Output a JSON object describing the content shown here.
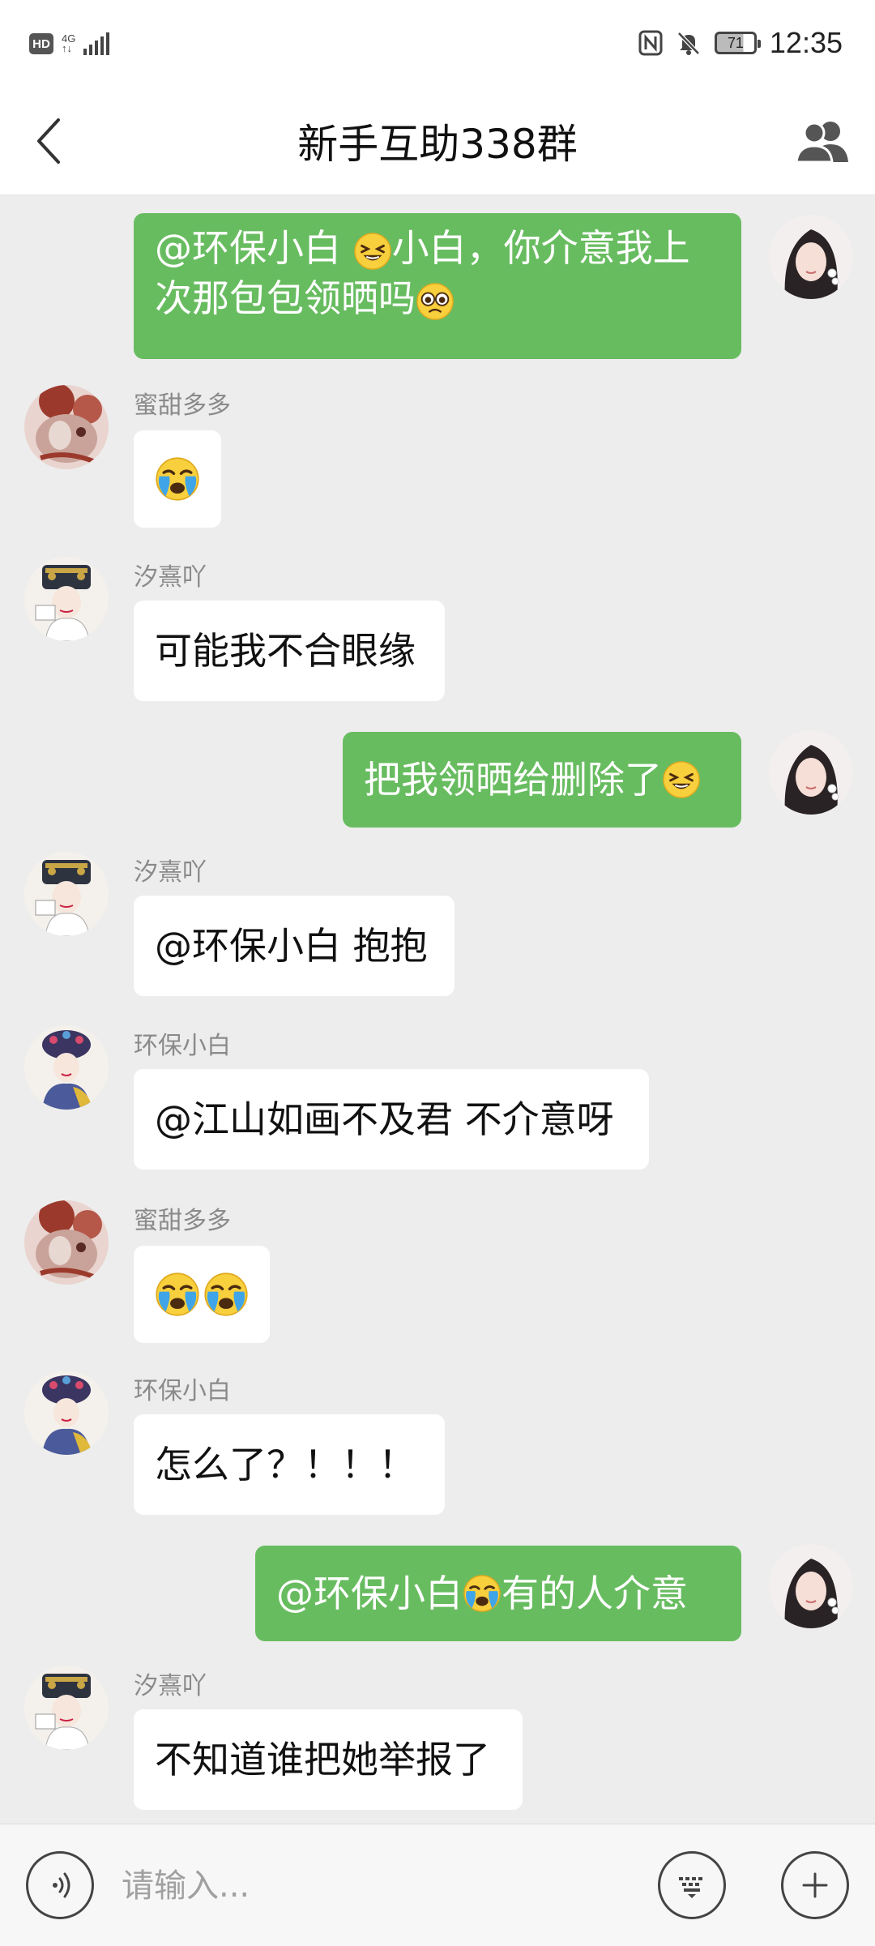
{
  "status_bar": {
    "hd": "HD",
    "network": "4G",
    "network_sub": "↑↓",
    "battery": "71",
    "time": "12:35"
  },
  "header": {
    "title": "新手互助338群",
    "back_icon": "chevron-left-icon",
    "members_icon": "group-members-icon"
  },
  "messages": [
    {
      "side": "out",
      "text_before": "@环保小白 ",
      "emoji1": "squint-laugh",
      "text_mid": "小白，你介意我上",
      "line2": "次那包包领晒吗",
      "emoji2": "pleading"
    },
    {
      "side": "in",
      "sender": "蜜甜多多",
      "emoji": "crying"
    },
    {
      "side": "in",
      "sender": "汐熹吖",
      "text": "可能我不合眼缘"
    },
    {
      "side": "out",
      "text": "把我领晒给删除了",
      "emoji": "squint-laugh"
    },
    {
      "side": "in",
      "sender": "汐熹吖",
      "text": "@环保小白 抱抱"
    },
    {
      "side": "in",
      "sender": "环保小白",
      "text": "@江山如画不及君 不介意呀"
    },
    {
      "side": "in",
      "sender": "蜜甜多多",
      "emoji": "crying",
      "emoji_count": 2
    },
    {
      "side": "in",
      "sender": "环保小白",
      "text": "怎么了？！！！"
    },
    {
      "side": "out",
      "text_before": "@环保小白 ",
      "emoji": "crying",
      "text_after": "有的人介意"
    },
    {
      "side": "in",
      "sender": "汐熹吖",
      "text": "不知道谁把她举报了"
    }
  ],
  "input_bar": {
    "placeholder": "请输入...",
    "voice_icon": "voice-icon",
    "keyboard_icon": "keyboard-icon",
    "plus_icon": "plus-icon"
  }
}
